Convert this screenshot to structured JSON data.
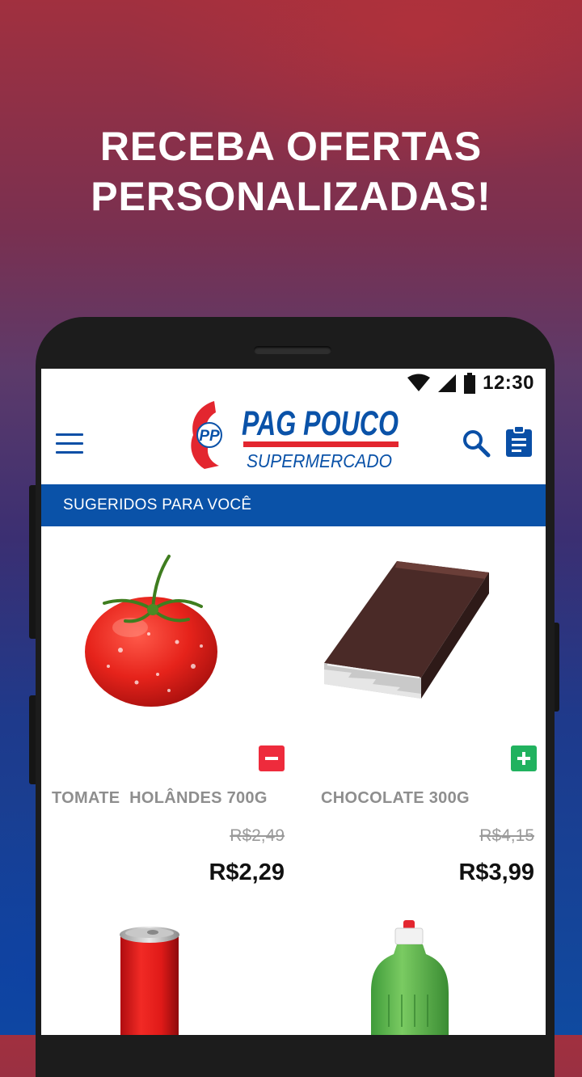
{
  "headline": {
    "line1": "RECEBA OFERTAS",
    "line2": "PERSONALIZADAS!"
  },
  "status_bar": {
    "time": "12:30"
  },
  "app_bar": {
    "logo": {
      "brand": "PAG POUCO",
      "subtitle": "SUPERMERCADO",
      "monogram": "PP"
    }
  },
  "section": {
    "title": "SUGERIDOS PARA VOCÊ"
  },
  "products": [
    {
      "name": "TOMATE  HOLÂNDES 700G",
      "old_price": "R$2,49",
      "price": "R$2,29",
      "action": "minus"
    },
    {
      "name": "CHOCOLATE 300G",
      "old_price": "R$4,15",
      "price": "R$3,99",
      "action": "plus"
    },
    {
      "name": "",
      "old_price": "",
      "price": "",
      "action": ""
    },
    {
      "name": "",
      "old_price": "",
      "price": "",
      "action": ""
    }
  ],
  "colors": {
    "brand_blue": "#0a52a8",
    "brand_red": "#e3262f",
    "minus_red": "#ee2b3c",
    "plus_green": "#21b25f"
  }
}
